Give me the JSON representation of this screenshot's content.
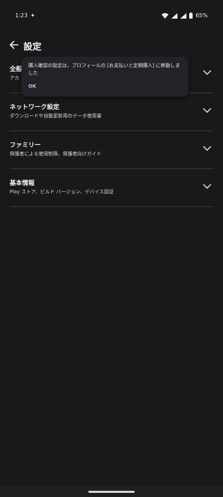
{
  "status_bar": {
    "time": "1:23",
    "battery": "65%"
  },
  "header": {
    "title": "設定"
  },
  "sections": [
    {
      "title": "全般",
      "subtitle": "アカ"
    },
    {
      "title": "ネットワーク設定",
      "subtitle": "ダウンロードや自動更新用のデータ使用量"
    },
    {
      "title": "ファミリー",
      "subtitle": "保護者による使用制限、保護者向けガイド"
    },
    {
      "title": "基本情報",
      "subtitle": "Play ストア、ビルド バージョン、デバイス認証"
    }
  ],
  "toast": {
    "message": "購入確認の設定は、プロフィールの [お支払いと定期購入] に移動しました",
    "action": "OK"
  },
  "colors": {
    "background": "#19191b",
    "divider": "#3b3b3e",
    "accent": "#a8c7fa"
  }
}
